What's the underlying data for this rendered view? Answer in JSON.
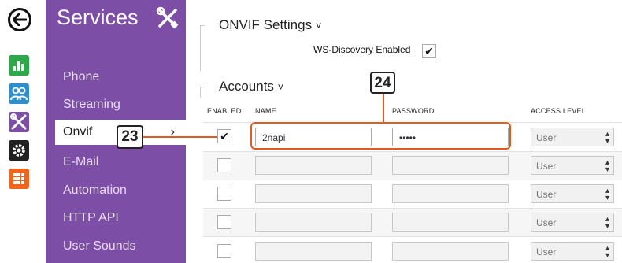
{
  "sidebar": {
    "title": "Services",
    "items": [
      {
        "label": "Phone"
      },
      {
        "label": "Streaming"
      },
      {
        "label": "Onvif"
      },
      {
        "label": "E-Mail"
      },
      {
        "label": "Automation"
      },
      {
        "label": "HTTP API"
      },
      {
        "label": "User Sounds"
      }
    ],
    "active_arrow": "›"
  },
  "rail": {
    "icons": [
      "back-arrow-icon",
      "bar-chart-icon",
      "users-icon",
      "tools-icon",
      "gear-icon",
      "grid-icon"
    ]
  },
  "onvif": {
    "title": "ONVIF Settings",
    "chevron": "˅",
    "ws_discovery_label": "WS-Discovery Enabled",
    "ws_discovery_checked": true
  },
  "accounts": {
    "title": "Accounts",
    "chevron": "˅",
    "columns": {
      "enabled": "ENABLED",
      "name": "NAME",
      "password": "PASSWORD",
      "access_level": "ACCESS LEVEL"
    },
    "rows": [
      {
        "enabled": true,
        "name": "2napi",
        "password": "•••••",
        "access_level": "User"
      },
      {
        "enabled": false,
        "name": "",
        "password": "",
        "access_level": "User"
      },
      {
        "enabled": false,
        "name": "",
        "password": "",
        "access_level": "User"
      },
      {
        "enabled": false,
        "name": "",
        "password": "",
        "access_level": "User"
      },
      {
        "enabled": false,
        "name": "",
        "password": "",
        "access_level": "User"
      }
    ]
  },
  "callouts": {
    "c23": "23",
    "c24": "24"
  },
  "colors": {
    "sidebar": "#7c4ea5",
    "accent_orange": "#e35a1c",
    "chart_green": "#2ea84a",
    "users_blue": "#2c8fcf",
    "tools_purple": "#7c4ea5",
    "gear_black": "#222222",
    "grid_orange": "#f0641e"
  }
}
